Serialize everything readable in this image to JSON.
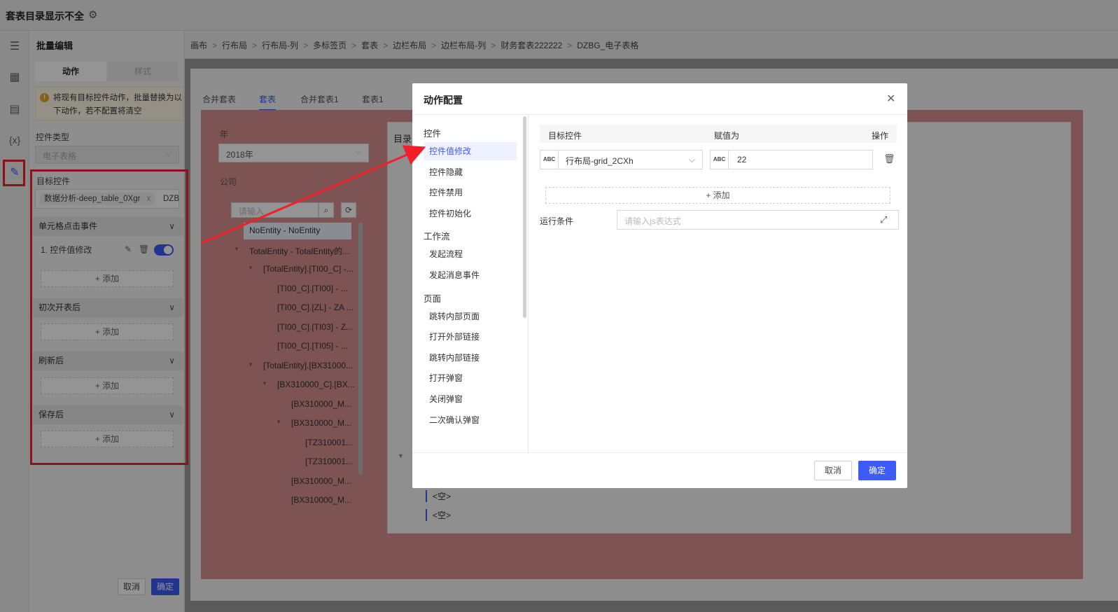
{
  "app": {
    "title": "套表目录显示不全"
  },
  "left_panel": {
    "title": "批量编辑",
    "tabs": [
      "动作",
      "样式"
    ],
    "warning": "将现有目标控件动作，批量替换为以下动作，若不配置将清空",
    "control_type_label": "控件类型",
    "control_type_value": "电子表格",
    "target_label": "目标控件",
    "target_tags": [
      "数据分析-deep_table_0Xgr",
      "DZB"
    ],
    "tag_close": "x",
    "sections": [
      {
        "title": "单元格点击事件",
        "items": [
          {
            "label": "1. 控件值修改",
            "enabled": true
          }
        ],
        "add": "+ 添加"
      },
      {
        "title": "初次开表后",
        "items": [],
        "add": "+ 添加"
      },
      {
        "title": "刷新后",
        "items": [],
        "add": "+ 添加"
      },
      {
        "title": "保存后",
        "items": [],
        "add": "+ 添加"
      }
    ],
    "cancel": "取消",
    "confirm": "确定"
  },
  "breadcrumb": [
    "画布",
    "行布局",
    "行布局-列",
    "多标签页",
    "套表",
    "边栏布局",
    "边栏布局-列",
    "财务套表222222",
    "DZBG_电子表格"
  ],
  "breadcrumb_sep": ">",
  "canvas": {
    "tabs": [
      "合并套表",
      "套表",
      "合并套表1",
      "套表1"
    ],
    "active_tab": 1,
    "year_label": "年",
    "year_value": "2018年",
    "company_label": "公司",
    "search_placeholder": "请输入",
    "tree": [
      {
        "text": "NoEntity - NoEntity",
        "depth": 0,
        "arrow": ""
      },
      {
        "text": "TotalEntity - TotalEntity的...",
        "depth": 0,
        "arrow": "▼"
      },
      {
        "text": "[TotalEntity].[TI00_C] -...",
        "depth": 1,
        "arrow": "▼"
      },
      {
        "text": "[TI00_C].[TI00] - ...",
        "depth": 2,
        "arrow": ""
      },
      {
        "text": "[TI00_C].[ZL] - ZA ...",
        "depth": 2,
        "arrow": ""
      },
      {
        "text": "[TI00_C].[TI03] - Z...",
        "depth": 2,
        "arrow": ""
      },
      {
        "text": "[TI00_C].[TI05] - ...",
        "depth": 2,
        "arrow": ""
      },
      {
        "text": "[TotalEntity].[BX31000...",
        "depth": 1,
        "arrow": "▼"
      },
      {
        "text": "[BX310000_C].[BX...",
        "depth": 2,
        "arrow": "▼"
      },
      {
        "text": "[BX310000_M...",
        "depth": 3,
        "arrow": ""
      },
      {
        "text": "[BX310000_M...",
        "depth": 3,
        "arrow": "▼"
      },
      {
        "text": "[TZ310001...",
        "depth": 4,
        "arrow": ""
      },
      {
        "text": "[TZ310001...",
        "depth": 4,
        "arrow": ""
      },
      {
        "text": "[BX310000_M...",
        "depth": 3,
        "arrow": ""
      },
      {
        "text": "[BX310000_M...",
        "depth": 3,
        "arrow": ""
      }
    ],
    "dir_title": "目录",
    "empty_items": [
      "<空>",
      "<空>"
    ]
  },
  "modal": {
    "title": "动作配置",
    "groups": [
      {
        "title": "控件",
        "items": [
          "控件值修改",
          "控件隐藏",
          "控件禁用",
          "控件初始化"
        ]
      },
      {
        "title": "工作流",
        "items": [
          "发起流程",
          "发起消息事件"
        ]
      },
      {
        "title": "页面",
        "items": [
          "跳转内部页面",
          "打开外部链接",
          "跳转内部链接",
          "打开弹窗",
          "关闭弹窗",
          "二次确认弹窗"
        ]
      }
    ],
    "active_item": "控件值修改",
    "col_target": "目标控件",
    "col_value": "赋值为",
    "col_op": "操作",
    "row_target": "行布局-grid_2CXh",
    "row_value": "22",
    "abc": "ABC",
    "add": "+ 添加",
    "cond_label": "运行条件",
    "cond_placeholder": "请输入js表达式",
    "cancel": "取消",
    "confirm": "确定"
  },
  "colors": {
    "accent": "#3d5bf5",
    "highlight_red": "#f0202a",
    "pink": "#d98f8f"
  }
}
